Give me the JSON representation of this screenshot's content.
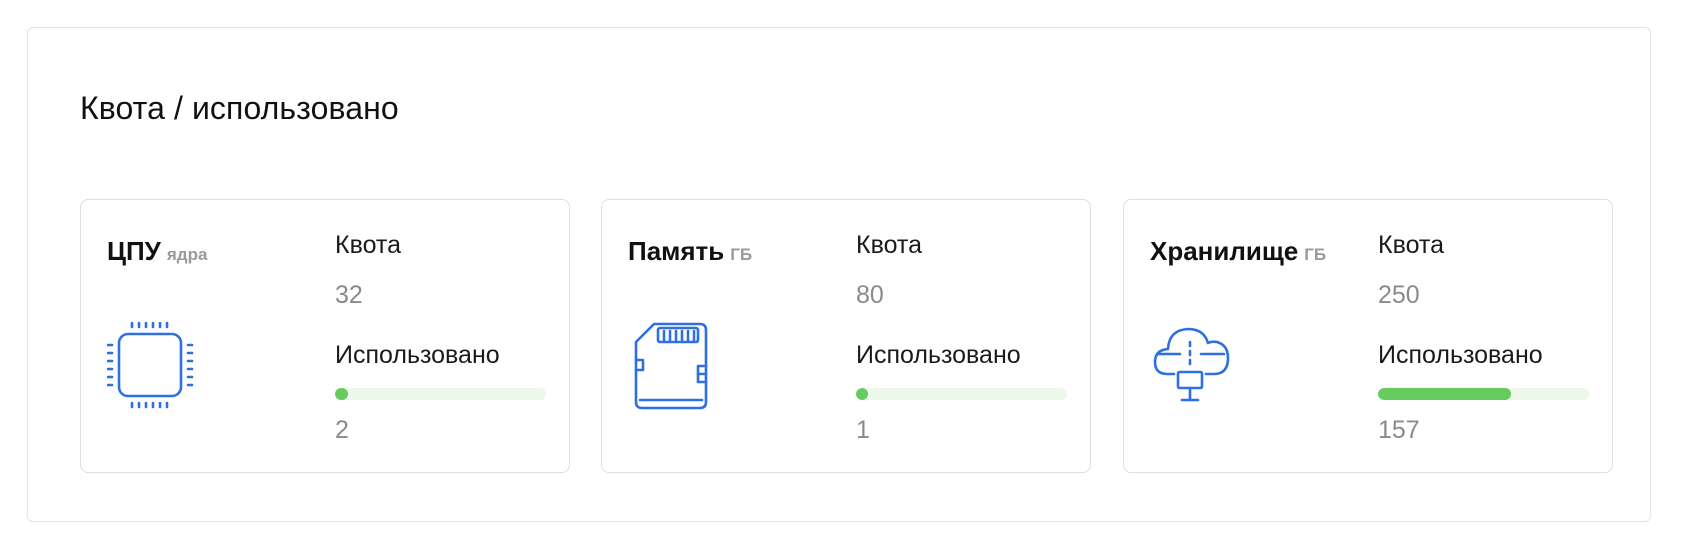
{
  "panel": {
    "title": "Квота / использовано"
  },
  "colors": {
    "accent_icon": "#2f6fe0",
    "bar_fill": "#66cc5f",
    "bar_track": "#edf7ea"
  },
  "cards": [
    {
      "name": "ЦПУ",
      "unit": "ядра",
      "icon": "cpu-chip-icon",
      "quota_label": "Квота",
      "quota_value": "32",
      "used_label": "Использовано",
      "used_value": "2",
      "used_fraction": 0.0625
    },
    {
      "name": "Память",
      "unit": "ГБ",
      "icon": "memory-card-icon",
      "quota_label": "Квота",
      "quota_value": "80",
      "used_label": "Использовано",
      "used_value": "1",
      "used_fraction": 0.0125
    },
    {
      "name": "Хранилище",
      "unit": "ГБ",
      "icon": "cloud-storage-icon",
      "quota_label": "Квота",
      "quota_value": "250",
      "used_label": "Использовано",
      "used_value": "157",
      "used_fraction": 0.628
    }
  ]
}
